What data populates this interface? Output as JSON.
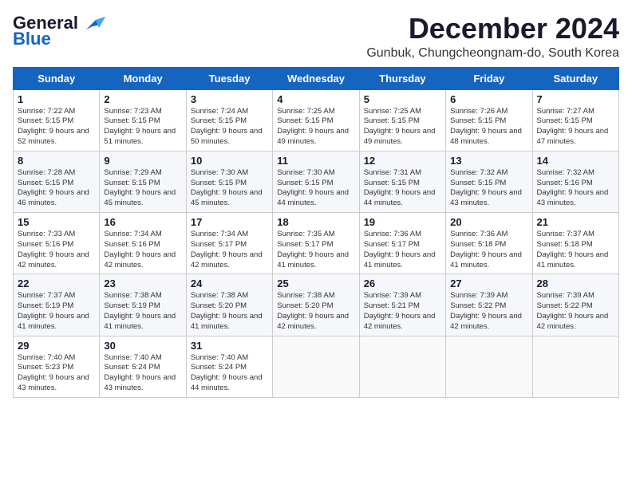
{
  "header": {
    "logo_general": "General",
    "logo_blue": "Blue",
    "month": "December 2024",
    "location": "Gunbuk, Chungcheongnam-do, South Korea"
  },
  "weekdays": [
    "Sunday",
    "Monday",
    "Tuesday",
    "Wednesday",
    "Thursday",
    "Friday",
    "Saturday"
  ],
  "weeks": [
    [
      {
        "day": "1",
        "sunrise": "7:22 AM",
        "sunset": "5:15 PM",
        "daylight": "9 hours and 52 minutes."
      },
      {
        "day": "2",
        "sunrise": "7:23 AM",
        "sunset": "5:15 PM",
        "daylight": "9 hours and 51 minutes."
      },
      {
        "day": "3",
        "sunrise": "7:24 AM",
        "sunset": "5:15 PM",
        "daylight": "9 hours and 50 minutes."
      },
      {
        "day": "4",
        "sunrise": "7:25 AM",
        "sunset": "5:15 PM",
        "daylight": "9 hours and 49 minutes."
      },
      {
        "day": "5",
        "sunrise": "7:25 AM",
        "sunset": "5:15 PM",
        "daylight": "9 hours and 49 minutes."
      },
      {
        "day": "6",
        "sunrise": "7:26 AM",
        "sunset": "5:15 PM",
        "daylight": "9 hours and 48 minutes."
      },
      {
        "day": "7",
        "sunrise": "7:27 AM",
        "sunset": "5:15 PM",
        "daylight": "9 hours and 47 minutes."
      }
    ],
    [
      {
        "day": "8",
        "sunrise": "7:28 AM",
        "sunset": "5:15 PM",
        "daylight": "9 hours and 46 minutes."
      },
      {
        "day": "9",
        "sunrise": "7:29 AM",
        "sunset": "5:15 PM",
        "daylight": "9 hours and 45 minutes."
      },
      {
        "day": "10",
        "sunrise": "7:30 AM",
        "sunset": "5:15 PM",
        "daylight": "9 hours and 45 minutes."
      },
      {
        "day": "11",
        "sunrise": "7:30 AM",
        "sunset": "5:15 PM",
        "daylight": "9 hours and 44 minutes."
      },
      {
        "day": "12",
        "sunrise": "7:31 AM",
        "sunset": "5:15 PM",
        "daylight": "9 hours and 44 minutes."
      },
      {
        "day": "13",
        "sunrise": "7:32 AM",
        "sunset": "5:15 PM",
        "daylight": "9 hours and 43 minutes."
      },
      {
        "day": "14",
        "sunrise": "7:32 AM",
        "sunset": "5:16 PM",
        "daylight": "9 hours and 43 minutes."
      }
    ],
    [
      {
        "day": "15",
        "sunrise": "7:33 AM",
        "sunset": "5:16 PM",
        "daylight": "9 hours and 42 minutes."
      },
      {
        "day": "16",
        "sunrise": "7:34 AM",
        "sunset": "5:16 PM",
        "daylight": "9 hours and 42 minutes."
      },
      {
        "day": "17",
        "sunrise": "7:34 AM",
        "sunset": "5:17 PM",
        "daylight": "9 hours and 42 minutes."
      },
      {
        "day": "18",
        "sunrise": "7:35 AM",
        "sunset": "5:17 PM",
        "daylight": "9 hours and 41 minutes."
      },
      {
        "day": "19",
        "sunrise": "7:36 AM",
        "sunset": "5:17 PM",
        "daylight": "9 hours and 41 minutes."
      },
      {
        "day": "20",
        "sunrise": "7:36 AM",
        "sunset": "5:18 PM",
        "daylight": "9 hours and 41 minutes."
      },
      {
        "day": "21",
        "sunrise": "7:37 AM",
        "sunset": "5:18 PM",
        "daylight": "9 hours and 41 minutes."
      }
    ],
    [
      {
        "day": "22",
        "sunrise": "7:37 AM",
        "sunset": "5:19 PM",
        "daylight": "9 hours and 41 minutes."
      },
      {
        "day": "23",
        "sunrise": "7:38 AM",
        "sunset": "5:19 PM",
        "daylight": "9 hours and 41 minutes."
      },
      {
        "day": "24",
        "sunrise": "7:38 AM",
        "sunset": "5:20 PM",
        "daylight": "9 hours and 41 minutes."
      },
      {
        "day": "25",
        "sunrise": "7:38 AM",
        "sunset": "5:20 PM",
        "daylight": "9 hours and 42 minutes."
      },
      {
        "day": "26",
        "sunrise": "7:39 AM",
        "sunset": "5:21 PM",
        "daylight": "9 hours and 42 minutes."
      },
      {
        "day": "27",
        "sunrise": "7:39 AM",
        "sunset": "5:22 PM",
        "daylight": "9 hours and 42 minutes."
      },
      {
        "day": "28",
        "sunrise": "7:39 AM",
        "sunset": "5:22 PM",
        "daylight": "9 hours and 42 minutes."
      }
    ],
    [
      {
        "day": "29",
        "sunrise": "7:40 AM",
        "sunset": "5:23 PM",
        "daylight": "9 hours and 43 minutes."
      },
      {
        "day": "30",
        "sunrise": "7:40 AM",
        "sunset": "5:24 PM",
        "daylight": "9 hours and 43 minutes."
      },
      {
        "day": "31",
        "sunrise": "7:40 AM",
        "sunset": "5:24 PM",
        "daylight": "9 hours and 44 minutes."
      },
      null,
      null,
      null,
      null
    ]
  ]
}
